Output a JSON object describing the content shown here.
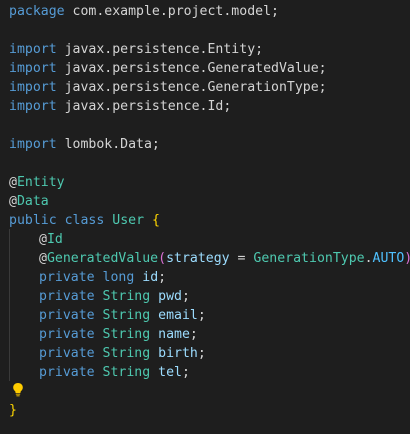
{
  "lines": {
    "l1": {
      "kw": "package",
      "rest": " com.example.project.model;"
    },
    "l3": {
      "kw": "import",
      "rest": " javax.persistence.Entity;"
    },
    "l4": {
      "kw": "import",
      "rest": " javax.persistence.GeneratedValue;"
    },
    "l5": {
      "kw": "import",
      "rest": " javax.persistence.GenerationType;"
    },
    "l6": {
      "kw": "import",
      "rest": " javax.persistence.Id;"
    },
    "l8": {
      "kw": "import",
      "rest": " lombok.Data;"
    },
    "l10": {
      "at": "@",
      "name": "Entity"
    },
    "l11": {
      "at": "@",
      "name": "Data"
    },
    "l12": {
      "kw1": "public",
      "kw2": "class",
      "cls": "User",
      "brace": "{"
    },
    "l13": {
      "at": "@",
      "name": "Id"
    },
    "l14": {
      "at": "@",
      "name": "GeneratedValue",
      "open": "(",
      "param": "strategy",
      "eq": " = ",
      "type": "GenerationType",
      "dot": ".",
      "const": "AUTO",
      "close": ")"
    },
    "l15": {
      "kw": "private",
      "type": "long",
      "name": "id",
      "semi": ";"
    },
    "l16": {
      "kw": "private",
      "type": "String",
      "name": "pwd",
      "semi": ";"
    },
    "l17": {
      "kw": "private",
      "type": "String",
      "name": "email",
      "semi": ";"
    },
    "l18": {
      "kw": "private",
      "type": "String",
      "name": "name",
      "semi": ";"
    },
    "l19": {
      "kw": "private",
      "type": "String",
      "name": "birth",
      "semi": ";"
    },
    "l20": {
      "kw": "private",
      "type": "String",
      "name": "tel",
      "semi": ";"
    },
    "l22": {
      "brace": "}"
    }
  },
  "colors": {
    "background": "#1e1e1e",
    "keyword": "#569cd6",
    "type": "#4ec9b0",
    "variable": "#9cdcfe",
    "brace": "#ffd700",
    "paren": "#da70d6",
    "constant": "#4fc1ff",
    "lightbulb": "#ffcc00"
  },
  "icons": {
    "gutter": "lightbulb-icon"
  }
}
